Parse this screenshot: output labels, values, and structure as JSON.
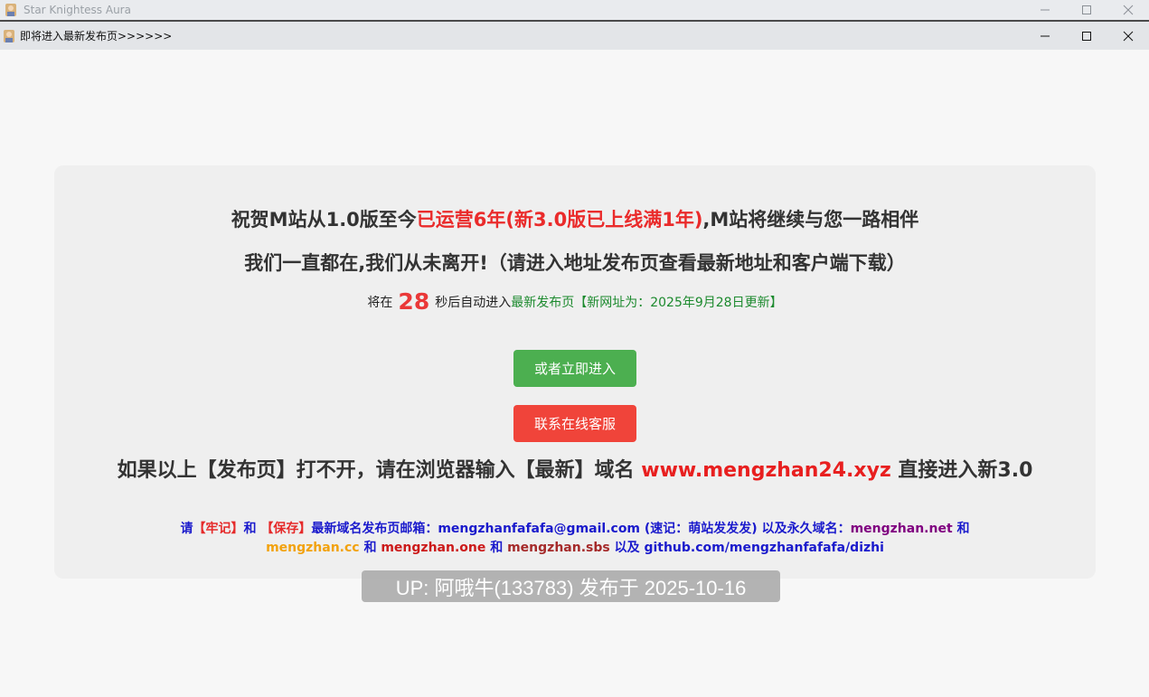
{
  "outer_window": {
    "title": "Star Knightess Aura"
  },
  "inner_window": {
    "title": "即将进入最新发布页>>>>>>"
  },
  "headline": {
    "line1_prefix": "祝贺M站从1.0版至今",
    "line1_highlight": "已运营6年(新3.0版已上线满1年)",
    "line1_suffix": ",M站将继续与您一路相伴",
    "line2": "我们一直都在,我们从未离开!（请进入地址发布页查看最新地址和客户端下载）"
  },
  "countdown": {
    "prefix": "将在",
    "seconds": "28",
    "middle": "秒后自动进入",
    "link_text": "最新发布页【新网址为：2025年9月28日更新】"
  },
  "buttons": {
    "enter_now": "或者立即进入",
    "contact_service": "联系在线客服"
  },
  "fallback": {
    "prefix": "如果以上【发布页】打不开，请在浏览器输入【最新】域名",
    "domain": "www.mengzhan24.xyz",
    "suffix": "直接进入新3.0"
  },
  "note": {
    "t1": "请",
    "t2": "【牢记】",
    "t3": "和",
    "t4": "【保存】",
    "t5": "最新域名发布页邮箱：mengzhanfafafa@gmail.com (速记：萌站发发发) 以及永久域名：",
    "d1": "mengzhan.net",
    "t6": "和",
    "d2": "mengzhan.cc",
    "t7": "和",
    "d3": "mengzhan.one",
    "t8": "和",
    "d4": "mengzhan.sbs",
    "t9": "以及 github.com/mengzhanfafafa/dizhi"
  },
  "watermark": "UP: 阿哦牛(133783) 发布于 2025-10-16",
  "colors": {
    "accent_red": "#ea2b2b",
    "button_green": "#4caf50",
    "button_red": "#f0443a",
    "link_green": "#1c8a2e",
    "note_blue": "#1a1acc"
  },
  "icons": [
    "app-icon",
    "minimize-icon",
    "maximize-icon",
    "close-icon"
  ]
}
